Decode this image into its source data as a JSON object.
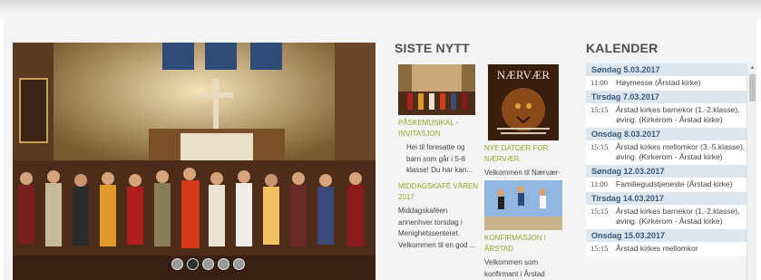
{
  "slideshow": {
    "dot_count": 5,
    "active_index": 1
  },
  "news": {
    "title": "SISTE NYTT",
    "items": [
      {
        "link": "PÅSKEMUSIKAL - INVITASJON",
        "text": "Hei til foresatte og barn som går i  5-8 klasse! Du har kan..."
      },
      {
        "link": "MIDDAGSKAFÉ VÅREN 2017",
        "text": "Middagskaféen annenhver torsdag i Menighetssenteret. Velkommen til en god ..."
      },
      {
        "link": "NYE DATOER FOR NÆRVÆR.",
        "text": "Velkommen til Nærvær-",
        "thumb_caption": "NÆRVÆR"
      },
      {
        "link": "KONFIRMASJON I ÅRSTAD",
        "text": "Velkommen som konfirmant i Årstad"
      }
    ]
  },
  "calendar": {
    "title": "KALENDER",
    "days": [
      {
        "date": "Søndag 5.03.2017",
        "events": [
          {
            "time": "11:00",
            "text": "Høymesse (Årstad kirke)"
          }
        ]
      },
      {
        "date": "Tirsdag 7.03.2017",
        "events": [
          {
            "time": "15:15",
            "text": "Årstad kirkes barnekor (1.-2.klasse), øving. (Kirkerom - Årstad kirke)"
          }
        ]
      },
      {
        "date": "Onsdag 8.03.2017",
        "events": [
          {
            "time": "15:15",
            "text": "Årstad kirkes mellomkor (3.-5.klasse), øving. (Kirkerom - Årstad kirke)"
          }
        ]
      },
      {
        "date": "Søndag 12.03.2017",
        "events": [
          {
            "time": "11:00",
            "text": "Familiegudstjeneste (Årstad kirke)"
          }
        ]
      },
      {
        "date": "Tirsdag 14.03.2017",
        "events": [
          {
            "time": "15:15",
            "text": "Årstad kirkes barnekor (1.-2.klasse), øving. (Kirkerom - Årstad kirke)"
          }
        ]
      },
      {
        "date": "Onsdag 15.03.2017",
        "events": [
          {
            "time": "15:15",
            "text": "Årstad kirkes mellomkor"
          }
        ]
      }
    ]
  }
}
